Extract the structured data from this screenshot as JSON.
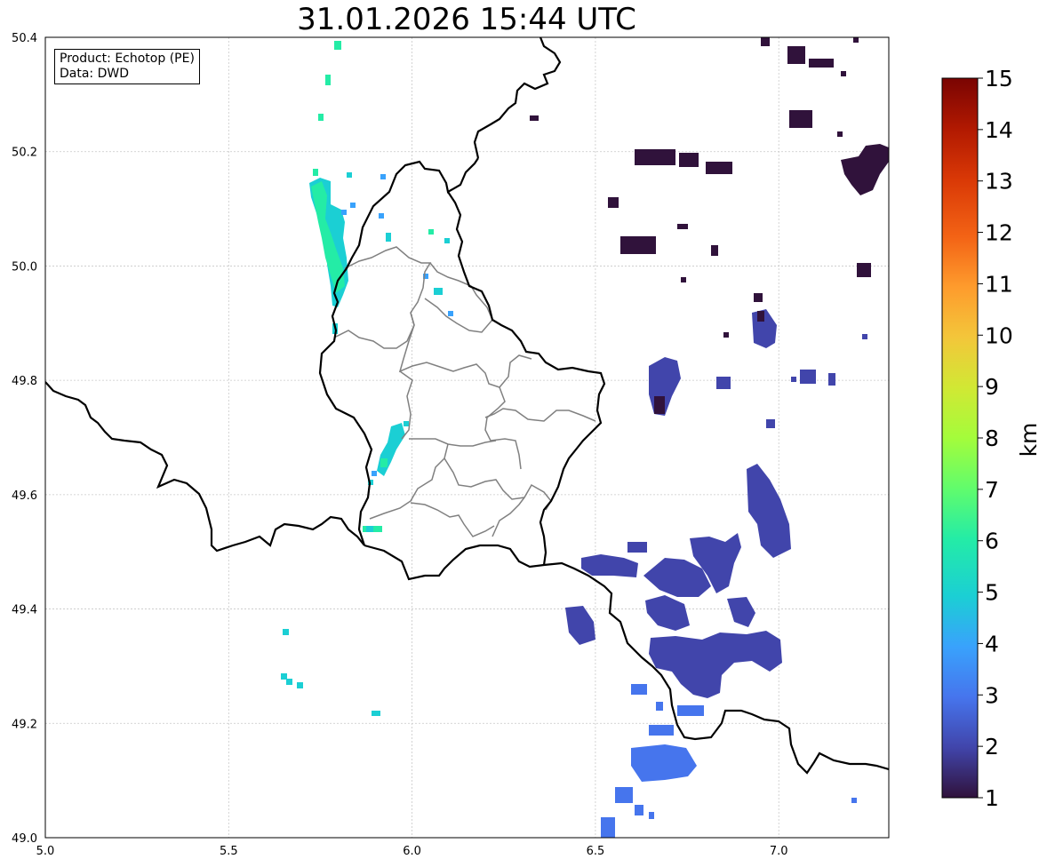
{
  "title": "31.01.2026 15:44 UTC",
  "infobox": {
    "line1": "Product: Echotop (PE)",
    "line2": "Data: DWD"
  },
  "map": {
    "lon_range": [
      5.0,
      7.3
    ],
    "lat_range": [
      49.0,
      50.4
    ],
    "x_ticks": [
      "5.0",
      "5.5",
      "6.0",
      "6.5",
      "7.0"
    ],
    "y_ticks": [
      "49.0",
      "49.2",
      "49.4",
      "49.6",
      "49.8",
      "50.0",
      "50.2",
      "50.4"
    ],
    "grid": true
  },
  "colorbar": {
    "label": "km",
    "min": 1,
    "max": 15,
    "ticks": [
      "1",
      "2",
      "3",
      "4",
      "5",
      "6",
      "7",
      "8",
      "9",
      "10",
      "11",
      "12",
      "13",
      "14",
      "15"
    ],
    "colormap": "turbo",
    "colors": [
      "#30123b",
      "#4145ab",
      "#4675ed",
      "#39a2fc",
      "#1bcfd4",
      "#24eca6",
      "#61fc6c",
      "#a4fc3b",
      "#d1e834",
      "#f3c63a",
      "#fe9b2d",
      "#f36315",
      "#d93806",
      "#b11901",
      "#7a0402"
    ]
  },
  "echo_cells": [
    {
      "region": "west-band-north",
      "lon": 5.77,
      "lat": 50.05,
      "km": 5.6
    },
    {
      "region": "west-band-central",
      "lon": 5.92,
      "lat": 49.68,
      "km": 5.2
    },
    {
      "region": "south-west-speckles",
      "lon": 5.66,
      "lat": 49.29,
      "km": 5.0
    },
    {
      "region": "north-east-cells",
      "lon": 6.95,
      "lat": 50.2,
      "km": 1.3
    },
    {
      "region": "east-central-cells",
      "lon": 6.72,
      "lat": 49.78,
      "km": 1.8
    },
    {
      "region": "south-east-area",
      "lon": 6.78,
      "lat": 49.4,
      "km": 2.3
    },
    {
      "region": "far-south-east-area",
      "lon": 6.68,
      "lat": 49.12,
      "km": 3.1
    }
  ]
}
